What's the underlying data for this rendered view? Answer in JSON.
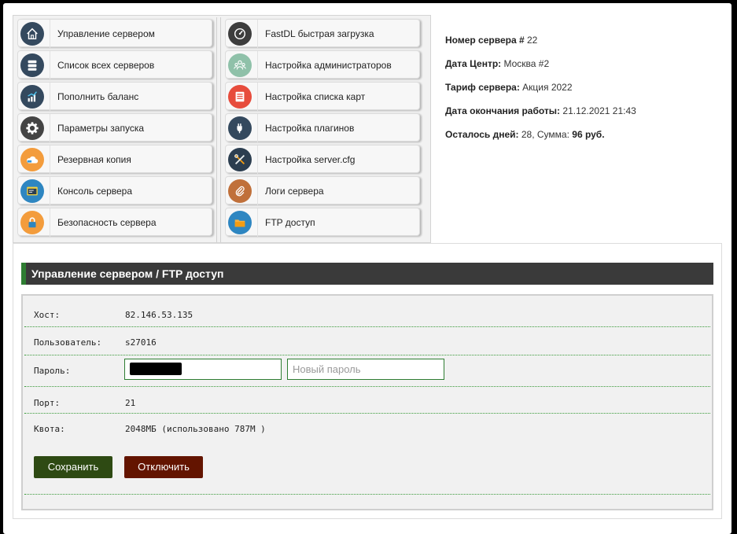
{
  "menu": {
    "left": [
      {
        "label": "Управление сервером",
        "icon": "home-icon",
        "color": "#34495e"
      },
      {
        "label": "Список всех серверов",
        "icon": "server-list-icon",
        "color": "#34495e"
      },
      {
        "label": "Пополнить баланс",
        "icon": "balance-chart-icon",
        "color": "#34495e"
      },
      {
        "label": "Параметры запуска",
        "icon": "gear-icon",
        "color": "#444444"
      },
      {
        "label": "Резервная копия",
        "icon": "cloud-backup-icon",
        "color": "#f39c3c"
      },
      {
        "label": "Консоль сервера",
        "icon": "console-icon",
        "color": "#2e86c1"
      },
      {
        "label": "Безопасность сервера",
        "icon": "lock-icon",
        "color": "#f39c3c"
      }
    ],
    "right": [
      {
        "label": "FastDL быстрая загрузка",
        "icon": "speedometer-icon",
        "color": "#3d3d3d"
      },
      {
        "label": "Настройка администраторов",
        "icon": "admins-icon",
        "color": "#8fc1a9"
      },
      {
        "label": "Настройка списка карт",
        "icon": "map-list-icon",
        "color": "#e74c3c"
      },
      {
        "label": "Настройка плагинов",
        "icon": "plugin-icon",
        "color": "#34495e"
      },
      {
        "label": "Настройка server.cfg",
        "icon": "tools-icon",
        "color": "#2c3e50"
      },
      {
        "label": "Логи сервера",
        "icon": "paperclip-icon",
        "color": "#c0703a"
      },
      {
        "label": "FTP доступ",
        "icon": "folder-icon",
        "color": "#2e86c1"
      }
    ]
  },
  "server_info": {
    "number_label": "Номер сервера #",
    "number_value": "22",
    "dc_label": "Дата Центр:",
    "dc_value": "Москва #2",
    "tariff_label": "Тариф сервера:",
    "tariff_value": "Акция 2022",
    "end_label": "Дата окончания работы:",
    "end_value": "21.12.2021 21:43",
    "days_label": "Осталось дней:",
    "days_value": "28,",
    "sum_label": "Сумма:",
    "sum_value": "96 руб."
  },
  "panel": {
    "title": "Управление сервером / FTP доступ",
    "host_label": "Хост:",
    "host_value": "82.146.53.135",
    "user_label": "Пользователь:",
    "user_value": "s27016",
    "pass_label": "Пароль:",
    "new_pass_placeholder": "Новый пароль",
    "port_label": "Порт:",
    "port_value": "21",
    "quota_label": "Квота:",
    "quota_value": "2048МБ (использовано 787M )",
    "save_label": "Сохранить",
    "disable_label": "Отключить"
  },
  "colors": {
    "accent_green": "#2e7d32",
    "save_button": "#2e4a13",
    "disable_button": "#631400",
    "title_bar": "#3a3a3a"
  }
}
